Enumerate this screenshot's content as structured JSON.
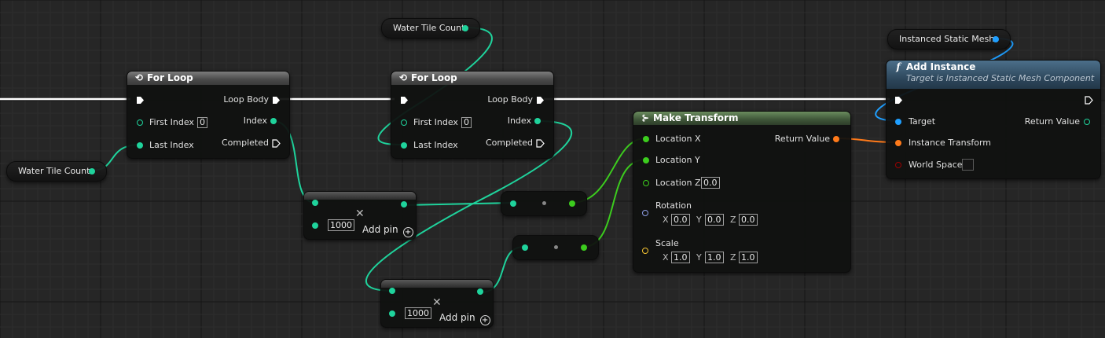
{
  "for_loop_1": {
    "title": "For Loop",
    "first_index_label": "First Index",
    "first_index_value": "0",
    "last_index_label": "Last Index",
    "loop_body_label": "Loop Body",
    "index_label": "Index",
    "completed_label": "Completed"
  },
  "for_loop_2": {
    "title": "For Loop",
    "first_index_label": "First Index",
    "first_index_value": "0",
    "last_index_label": "Last Index",
    "loop_body_label": "Loop Body",
    "index_label": "Index",
    "completed_label": "Completed"
  },
  "water_tile_count_1": {
    "label": "Water Tile Count"
  },
  "water_tile_count_2": {
    "label": "Water Tile Count"
  },
  "multiply_1": {
    "value": "1000",
    "add_pin_label": "Add pin"
  },
  "multiply_2": {
    "value": "1000",
    "add_pin_label": "Add pin"
  },
  "make_transform": {
    "title": "Make Transform",
    "location_x_label": "Location X",
    "location_y_label": "Location Y",
    "location_z_label": "Location Z",
    "location_z_value": "0.0",
    "rotation_label": "Rotation",
    "rotation": {
      "x_label": "X",
      "x": "0.0",
      "y_label": "Y",
      "y": "0.0",
      "z_label": "Z",
      "z": "0.0"
    },
    "scale_label": "Scale",
    "scale": {
      "x_label": "X",
      "x": "1.0",
      "y_label": "Y",
      "y": "1.0",
      "z_label": "Z",
      "z": "1.0"
    },
    "return_value_label": "Return Value"
  },
  "instanced_static_mesh": {
    "label": "Instanced Static Mesh"
  },
  "add_instance": {
    "title": "Add Instance",
    "subtitle": "Target is Instanced Static Mesh Component",
    "target_label": "Target",
    "return_value_label": "Return Value",
    "instance_transform_label": "Instance Transform",
    "world_space_label": "World Space"
  },
  "colors": {
    "integer": "#1fd39c",
    "float": "#3ccc1e",
    "transform": "#ff7a1a",
    "object": "#1f9fff",
    "boolean": "#9b0000",
    "rotator": "#8e9ee6",
    "vector": "#f5c332",
    "exec": "#ffffff"
  }
}
